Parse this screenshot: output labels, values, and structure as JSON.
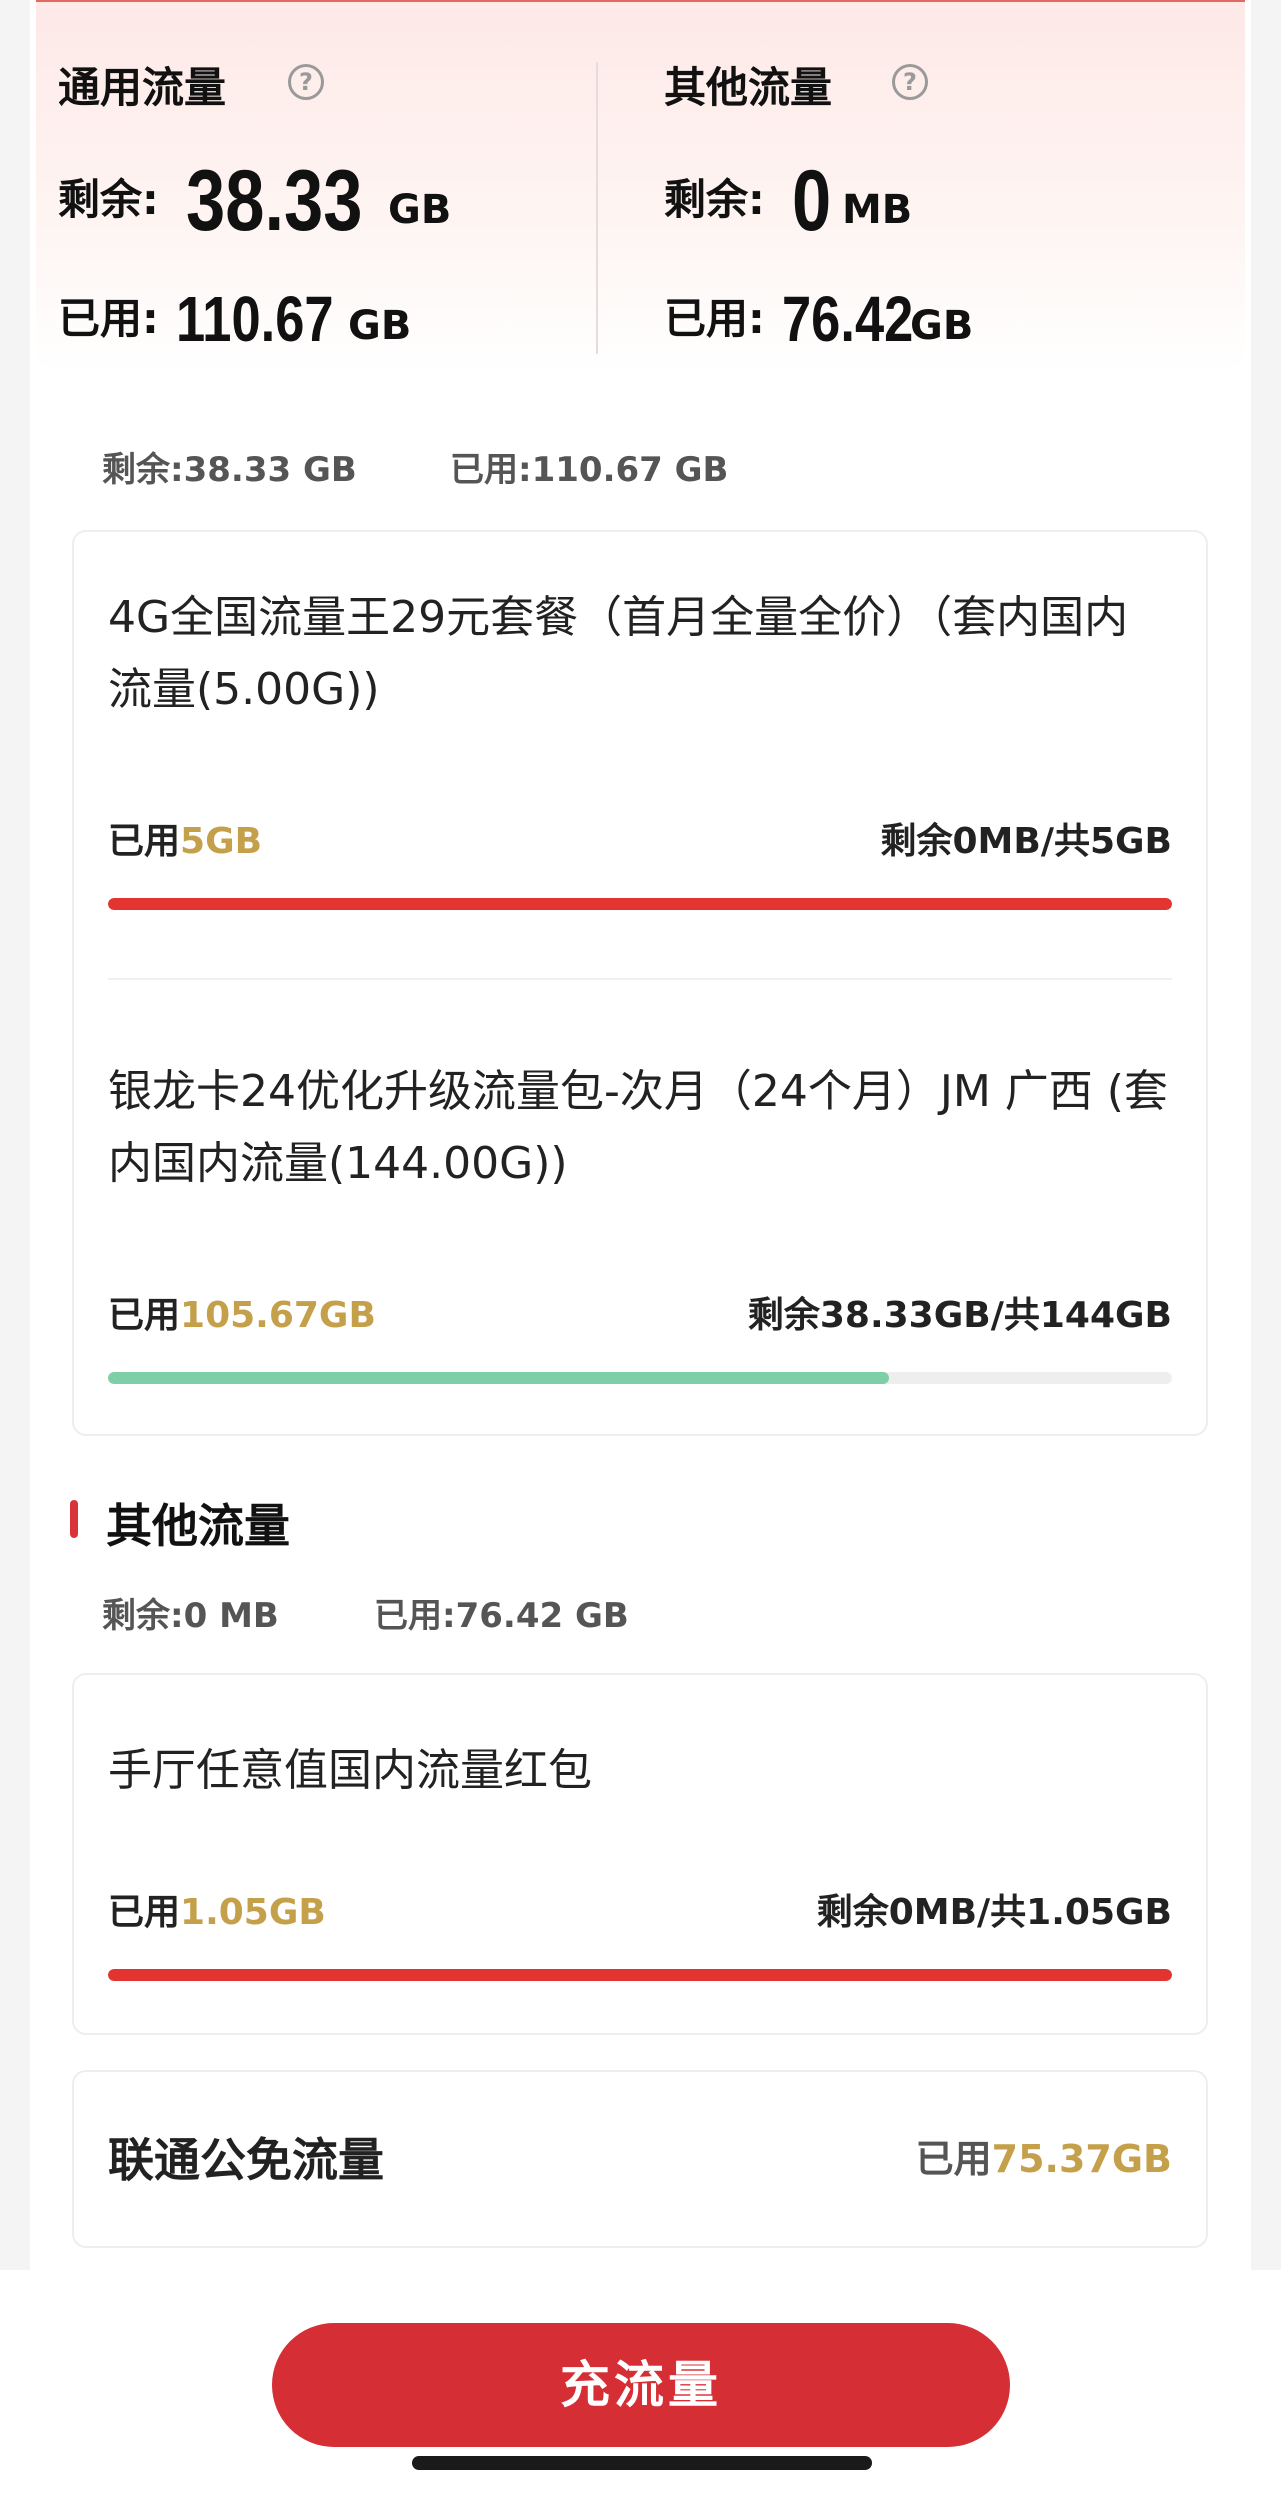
{
  "summary": {
    "general": {
      "title": "通用流量",
      "remain_label": "剩余:",
      "remain_value": "38.33",
      "remain_unit": "GB",
      "used_label": "已用:",
      "used_value": "110.67",
      "used_unit": "GB"
    },
    "other": {
      "title": "其他流量",
      "remain_label": "剩余:",
      "remain_value": "0",
      "remain_unit": "MB",
      "used_label": "已用:",
      "used_value": "76.42",
      "used_unit": "GB"
    },
    "help_glyph": "?"
  },
  "general_section": {
    "remain_text": "剩余:38.33 GB",
    "used_text": "已用:110.67 GB",
    "packages": [
      {
        "name": "4G全国流量王29元套餐（首月全量全价）（套内国内流量(5.00G))",
        "used_prefix": "已用",
        "used_value": "5GB",
        "remain_text": "剩余0MB/共5GB",
        "progress_used_fraction": 1.0,
        "bar_color": "#e3342f"
      },
      {
        "name": "银龙卡24优化升级流量包-次月（24个月）JM 广西 (套内国内流量(144.00G))",
        "used_prefix": "已用",
        "used_value": "105.67GB",
        "remain_text": "剩余38.33GB/共144GB",
        "progress_used_fraction": 0.734,
        "bar_color": "#7ecfa8"
      }
    ]
  },
  "other_section": {
    "title": "其他流量",
    "remain_text": "剩余:0 MB",
    "used_text": "已用:76.42 GB",
    "packages": [
      {
        "name": "手厅任意值国内流量红包",
        "used_prefix": "已用",
        "used_value": "1.05GB",
        "remain_text": "剩余0MB/共1.05GB",
        "progress_used_fraction": 1.0,
        "bar_color": "#e3342f"
      }
    ]
  },
  "free_traffic": {
    "name": "联通公免流量",
    "used_prefix": "已用",
    "used_value": "75.37GB"
  },
  "action": {
    "charge_label": "充流量"
  },
  "colors": {
    "accent_red": "#d52e34",
    "gold": "#c5a04a",
    "green_bar": "#7ecfa8"
  }
}
